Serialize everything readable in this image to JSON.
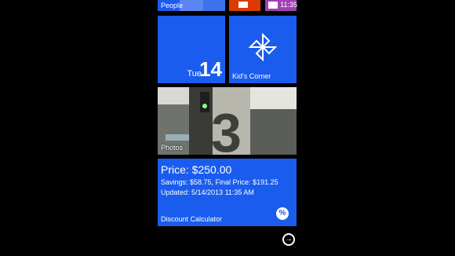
{
  "status": {
    "time": "11:35"
  },
  "tiles": {
    "people": {
      "label": "People"
    },
    "calendar": {
      "day": "Tue",
      "date": "14"
    },
    "kids_corner": {
      "label": "Kid's Corner"
    },
    "photos": {
      "label": "Photos"
    },
    "discount_calculator": {
      "label": "Discount Calculator",
      "price": "Price: $250.00",
      "savings": "Savings: $58.75, Final Price: $191.25",
      "updated": "Updated: 5/14/2013 11:35 AM"
    }
  },
  "navigation": {
    "arrow_icon": "arrow-right-circle-icon"
  },
  "colors": {
    "tile_blue": "#1a5ced",
    "office_orange": "#dc3b00",
    "messaging_purple": "#a33fb5"
  }
}
